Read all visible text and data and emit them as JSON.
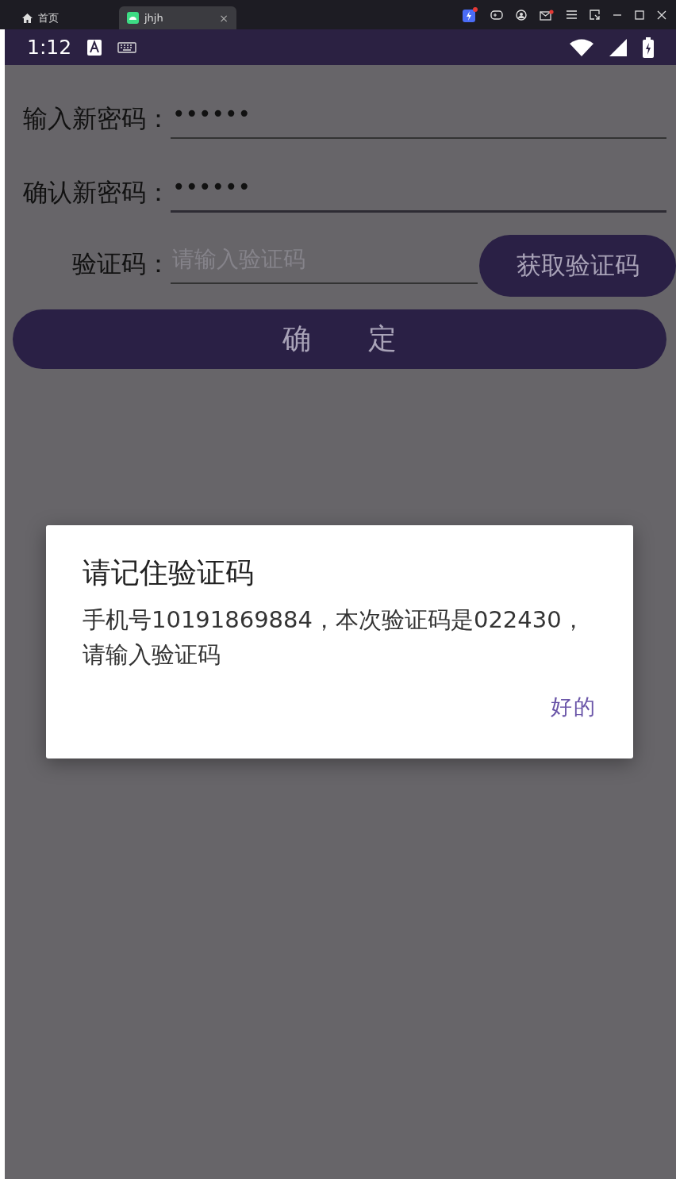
{
  "emulator_bar": {
    "tabs": [
      {
        "label": "首页",
        "kind": "home",
        "selected": false
      },
      {
        "label": "jhjh",
        "kind": "app",
        "selected": true,
        "close": "×"
      }
    ]
  },
  "status_bar": {
    "time": "1:12"
  },
  "form": {
    "fields": [
      {
        "label": "输入新密码：",
        "value": "••••••"
      },
      {
        "label": "确认新密码：",
        "value": "••••••"
      },
      {
        "label": "验证码：",
        "placeholder": "请输入验证码"
      }
    ],
    "get_code_button": "获取验证码",
    "confirm_button": "确　　定"
  },
  "dialog": {
    "title": "请记住验证码",
    "message": "手机号10191869884，本次验证码是022430，请输入验证码",
    "button": "好的"
  }
}
